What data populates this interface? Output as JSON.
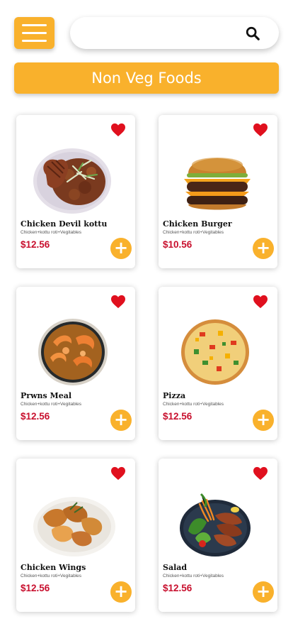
{
  "header": {
    "menu_icon": "hamburger-menu-icon",
    "search_placeholder": "",
    "search_icon": "search-icon"
  },
  "section_title": "Non Veg Foods",
  "colors": {
    "accent": "#f9b12c",
    "price": "#c8102e",
    "heart": "#e0101e"
  },
  "items": [
    {
      "name": "Chicken Devil kottu",
      "desc": "Chicken+kottu roti+Vegitables",
      "price": "$12.56",
      "add_label": "+",
      "favorite": true
    },
    {
      "name": "Chicken Burger",
      "desc": "Chicken+kottu roti+Vegitables",
      "price": "$10.56",
      "add_label": "+",
      "favorite": true
    },
    {
      "name": "Prwns Meal",
      "desc": "Chicken+kottu roti+Vegitables",
      "price": "$12.56",
      "add_label": "+",
      "favorite": true
    },
    {
      "name": "Pizza",
      "desc": "Chicken+kottu roti+Vegitables",
      "price": "$12.56",
      "add_label": "+",
      "favorite": true
    },
    {
      "name": "Chicken Wings",
      "desc": "Chicken+kottu roti+Vegitables",
      "price": "$12.56",
      "add_label": "+",
      "favorite": true
    },
    {
      "name": "Salad",
      "desc": "Chicken+kottu roti+Vegitables",
      "price": "$12.56",
      "add_label": "+",
      "favorite": true
    }
  ]
}
